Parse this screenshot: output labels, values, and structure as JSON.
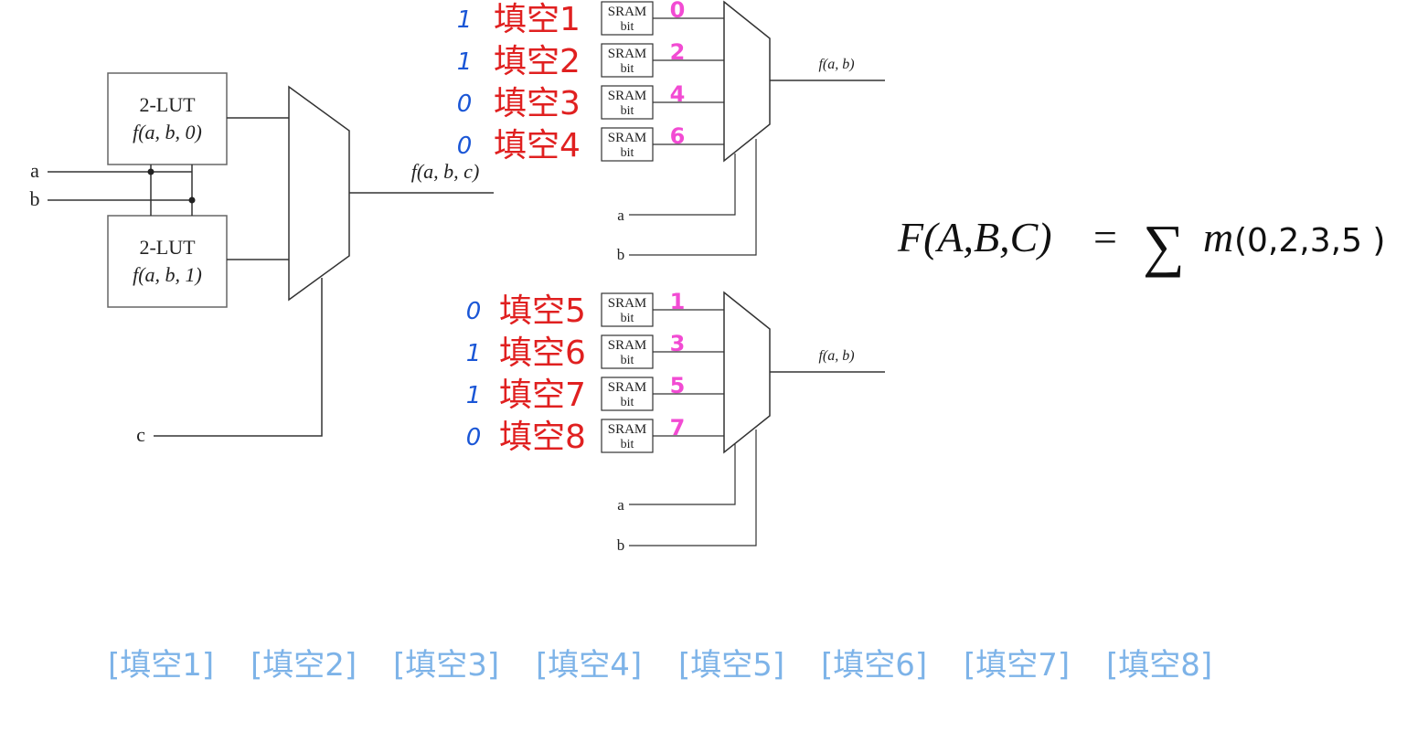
{
  "lut_top": {
    "title": "2-LUT",
    "func": "f(a, b, 0)"
  },
  "lut_bottom": {
    "title": "2-LUT",
    "func": "f(a, b, 1)"
  },
  "left_inputs": {
    "a": "a",
    "b": "b",
    "c": "c"
  },
  "main_output": "f(a, b, c)",
  "mux_output_top": "f(a, b)",
  "mux_output_bottom": "f(a, b)",
  "mux_select": {
    "a": "a",
    "b": "b"
  },
  "sram": {
    "line1": "SRAM",
    "line2": "bit"
  },
  "blank_labels": [
    "填空1",
    "填空2",
    "填空3",
    "填空4",
    "填空5",
    "填空6",
    "填空7",
    "填空8"
  ],
  "handwritten_bits": [
    "1",
    "1",
    "0",
    "0",
    "0",
    "1",
    "1",
    "0"
  ],
  "handwritten_minterms": [
    "0",
    "2",
    "4",
    "6",
    "1",
    "3",
    "5",
    "7"
  ],
  "formula": {
    "lhs": "F(A,B,C)",
    "equals": "=",
    "sigma": "∑",
    "m": "m",
    "terms": "(0,2,3,5 )"
  },
  "answer_fields": [
    "[填空1]",
    "[填空2]",
    "[填空3]",
    "[填空4]",
    "[填空5]",
    "[填空6]",
    "[填空7]",
    "[填空8]"
  ],
  "colors": {
    "label_red": "#e02020",
    "bits_blue": "#1a56d6",
    "minterm_pink": "#f24bd3",
    "answer_blue": "#7db3e8"
  }
}
